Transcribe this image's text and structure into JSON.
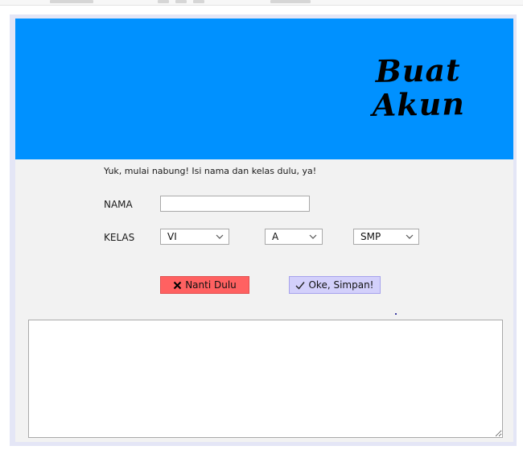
{
  "header": {
    "title_line1": "Buat",
    "title_line2": "Akun",
    "banner_color": "#0091ff"
  },
  "form": {
    "intro": "Yuk, mulai nabung! Isi nama dan kelas dulu, ya!",
    "nama_label": "NAMA",
    "nama_value": "",
    "kelas_label": "KELAS",
    "kelas_grade": "VI",
    "kelas_section": "A",
    "kelas_level": "SMP"
  },
  "buttons": {
    "cancel_label": "Nanti Dulu",
    "cancel_icon": "close-icon",
    "cancel_color": "#ff6161",
    "ok_label": "Oke, Simpan!",
    "ok_icon": "checkmark-icon",
    "ok_color": "#d3d0fb"
  },
  "output": {
    "text": ""
  }
}
